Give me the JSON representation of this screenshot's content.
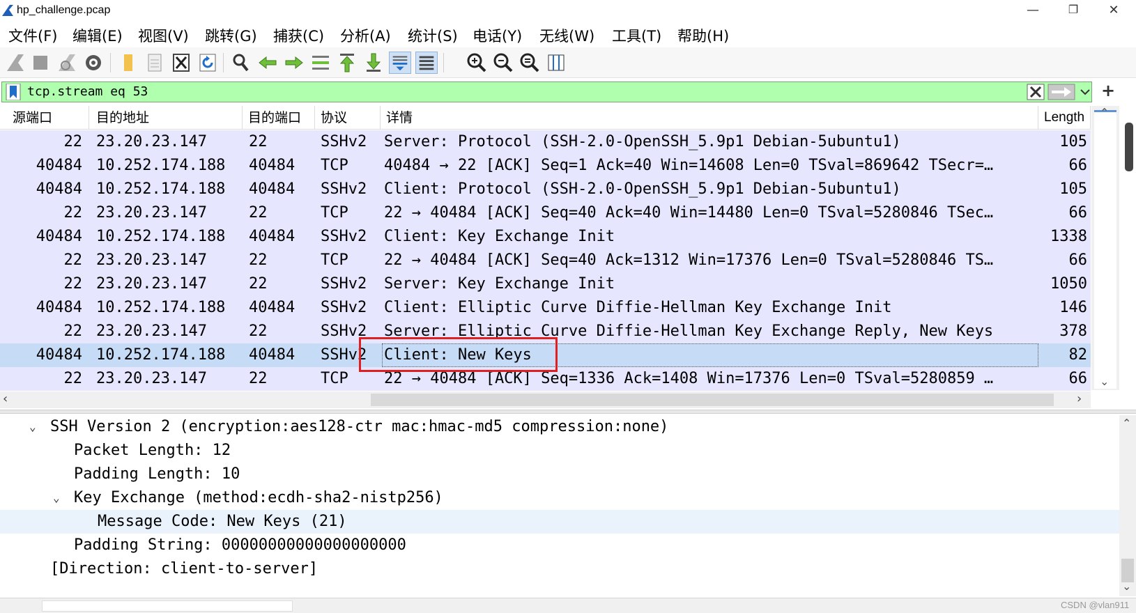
{
  "window": {
    "title": "hp_challenge.pcap",
    "minimize": "—",
    "restore": "❐",
    "close": "✕"
  },
  "menu": [
    "文件(F)",
    "编辑(E)",
    "视图(V)",
    "跳转(G)",
    "捕获(C)",
    "分析(A)",
    "统计(S)",
    "电话(Y)",
    "无线(W)",
    "工具(T)",
    "帮助(H)"
  ],
  "toolbar": {
    "icons": [
      "start-capture-icon",
      "stop-capture-icon",
      "restart-capture-icon",
      "capture-options-icon",
      "open-file-icon",
      "save-file-icon",
      "close-file-icon",
      "reload-icon",
      "find-packet-icon",
      "go-back-icon",
      "go-forward-icon",
      "go-to-packet-icon",
      "go-first-icon",
      "go-last-icon",
      "autoscroll-icon",
      "colorize-icon",
      "zoom-in-icon",
      "zoom-out-icon",
      "zoom-normal-icon",
      "resize-columns-icon"
    ]
  },
  "filter": {
    "value": "tcp.stream eq 53",
    "background": "#afffaf"
  },
  "packet_list": {
    "columns": [
      "源端口",
      "目的地址",
      "目的端口",
      "协议",
      "详情",
      "Length"
    ],
    "rows": [
      {
        "src_port": "22",
        "dst": "23.20.23.147",
        "dst_port": "22",
        "proto": "SSHv2",
        "info": "Server: Protocol (SSH-2.0-OpenSSH_5.9p1 Debian-5ubuntu1)",
        "length": "105"
      },
      {
        "src_port": "40484",
        "dst": "10.252.174.188",
        "dst_port": "40484",
        "proto": "TCP",
        "info": "40484 → 22 [ACK] Seq=1 Ack=40 Win=14608 Len=0 TSval=869642 TSecr=…",
        "length": "66"
      },
      {
        "src_port": "40484",
        "dst": "10.252.174.188",
        "dst_port": "40484",
        "proto": "SSHv2",
        "info": "Client: Protocol (SSH-2.0-OpenSSH_5.9p1 Debian-5ubuntu1)",
        "length": "105"
      },
      {
        "src_port": "22",
        "dst": "23.20.23.147",
        "dst_port": "22",
        "proto": "TCP",
        "info": "22 → 40484 [ACK] Seq=40 Ack=40 Win=14480 Len=0 TSval=5280846 TSec…",
        "length": "66"
      },
      {
        "src_port": "40484",
        "dst": "10.252.174.188",
        "dst_port": "40484",
        "proto": "SSHv2",
        "info": "Client: Key Exchange Init",
        "length": "1338"
      },
      {
        "src_port": "22",
        "dst": "23.20.23.147",
        "dst_port": "22",
        "proto": "TCP",
        "info": "22 → 40484 [ACK] Seq=40 Ack=1312 Win=17376 Len=0 TSval=5280846 TS…",
        "length": "66"
      },
      {
        "src_port": "22",
        "dst": "23.20.23.147",
        "dst_port": "22",
        "proto": "SSHv2",
        "info": "Server: Key Exchange Init",
        "length": "1050"
      },
      {
        "src_port": "40484",
        "dst": "10.252.174.188",
        "dst_port": "40484",
        "proto": "SSHv2",
        "info": "Client: Elliptic Curve Diffie-Hellman Key Exchange Init",
        "length": "146"
      },
      {
        "src_port": "22",
        "dst": "23.20.23.147",
        "dst_port": "22",
        "proto": "SSHv2",
        "info": "Server: Elliptic Curve Diffie-Hellman Key Exchange Reply, New Keys",
        "length": "378"
      },
      {
        "src_port": "40484",
        "dst": "10.252.174.188",
        "dst_port": "40484",
        "proto": "SSHv2",
        "info": "Client: New Keys",
        "length": "82"
      },
      {
        "src_port": "22",
        "dst": "23.20.23.147",
        "dst_port": "22",
        "proto": "TCP",
        "info": "22 → 40484 [ACK] Seq=1336 Ack=1408 Win=17376 Len=0 TSval=5280859 …",
        "length": "66"
      }
    ],
    "row_color": "#e7e6ff",
    "selected_color": "#c6dbf6",
    "highlight_color": "#e02020"
  },
  "details": [
    {
      "text": "SSH Version 2 (encryption:aes128-ctr mac:hmac-md5 compression:none)",
      "toggle": "⌄"
    },
    {
      "text": "Packet Length: 12",
      "toggle": ""
    },
    {
      "text": "Padding Length: 10",
      "toggle": ""
    },
    {
      "text": "Key Exchange (method:ecdh-sha2-nistp256)",
      "toggle": "⌄"
    },
    {
      "text": "Message Code: New Keys (21)",
      "toggle": ""
    },
    {
      "text": "Padding String: 00000000000000000000",
      "toggle": ""
    },
    {
      "text": "[Direction: client-to-server]",
      "toggle": ""
    }
  ],
  "watermark": "CSDN @vlan911"
}
